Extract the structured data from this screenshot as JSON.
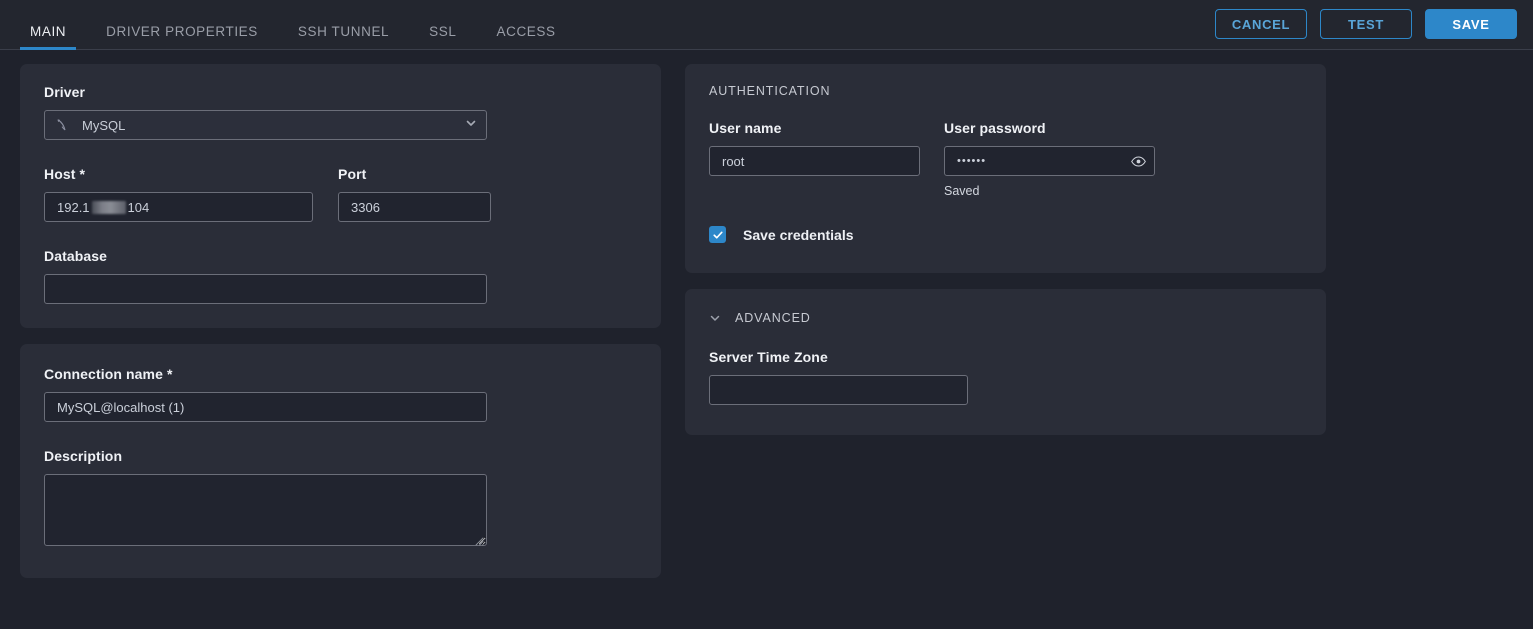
{
  "header": {
    "tabs": [
      {
        "label": "MAIN",
        "active": true
      },
      {
        "label": "DRIVER PROPERTIES",
        "active": false
      },
      {
        "label": "SSH TUNNEL",
        "active": false
      },
      {
        "label": "SSL",
        "active": false
      },
      {
        "label": "ACCESS",
        "active": false
      }
    ],
    "actions": {
      "cancel_label": "CANCEL",
      "test_label": "TEST",
      "save_label": "SAVE"
    }
  },
  "colors": {
    "accent": "#2d87c9",
    "page_bg": "#1f222c",
    "panel_bg": "#2a2d38",
    "header_bg": "#23262f",
    "input_bg": "#21242f",
    "input_border": "#6b6e79"
  },
  "connection": {
    "driver": {
      "label": "Driver",
      "icon": "mysql-dolphin-icon",
      "value": "MySQL",
      "chevron": "chevron-down-icon"
    },
    "host": {
      "label": "Host *",
      "value_prefix": "192.1",
      "value_redacted": true,
      "value_suffix": "104"
    },
    "port": {
      "label": "Port",
      "value": "3306"
    },
    "database": {
      "label": "Database",
      "value": "",
      "placeholder": ""
    },
    "connection_name": {
      "label": "Connection name *",
      "value": "MySQL@localhost (1)"
    },
    "description": {
      "label": "Description",
      "value": "",
      "placeholder": ""
    }
  },
  "authentication": {
    "title": "AUTHENTICATION",
    "user_name": {
      "label": "User name",
      "value": "root"
    },
    "user_password": {
      "label": "User password",
      "value": "••••••",
      "reveal_icon": "eye-icon",
      "status": "Saved"
    },
    "save_credentials": {
      "label": "Save credentials",
      "checked": true,
      "icon": "checkmark-icon"
    }
  },
  "advanced": {
    "title": "ADVANCED",
    "toggle_icon": "chevron-down-icon",
    "server_time_zone": {
      "label": "Server Time Zone",
      "value": "",
      "placeholder": ""
    }
  }
}
